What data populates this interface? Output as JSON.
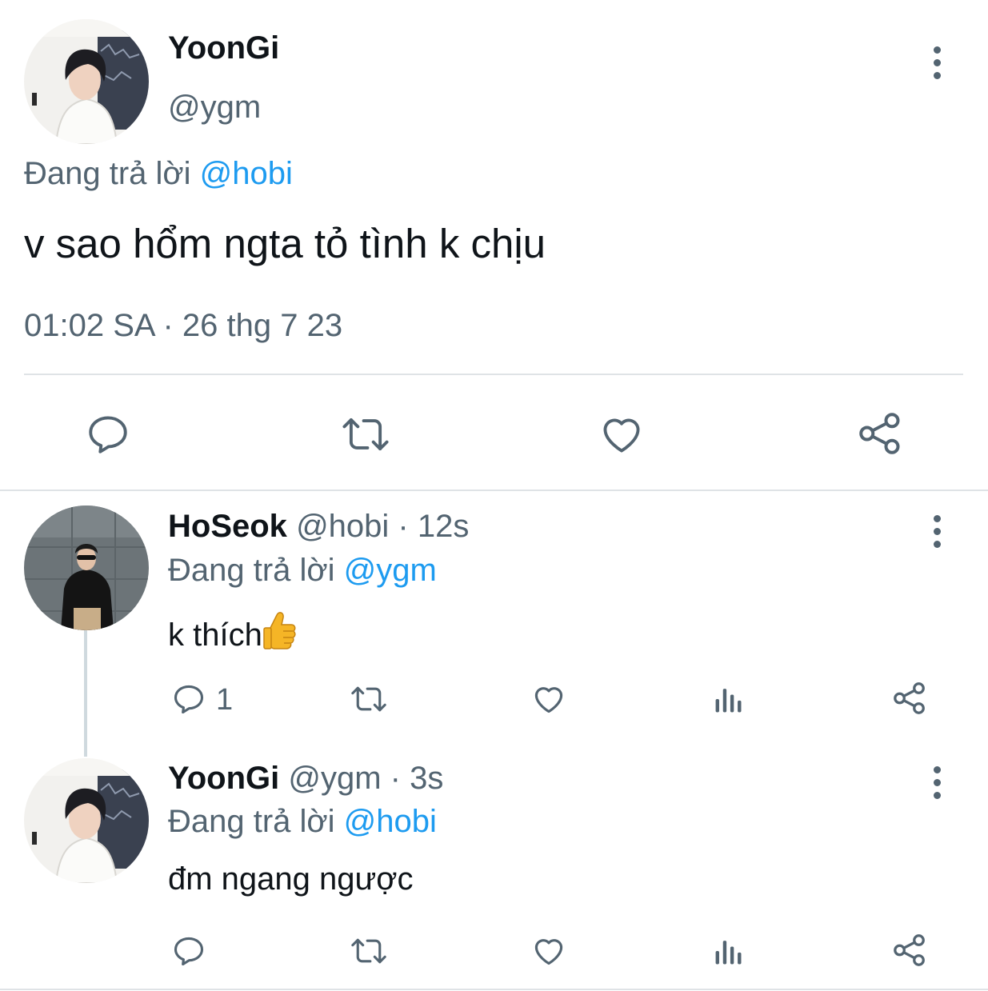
{
  "main_tweet": {
    "display_name": "YoonGi",
    "handle": "@ygm",
    "reply_prefix": "Đang trả lời",
    "reply_to": "@hobi",
    "text": "v sao hổm ngta tỏ tình k chịu",
    "timestamp": "01:02 SA · 26 thg 7 23",
    "actions": [
      "reply-icon",
      "retweet-icon",
      "like-icon",
      "share-icon"
    ]
  },
  "replies": [
    {
      "display_name": "HoSeok",
      "handle": "@hobi",
      "time": "· 12s",
      "reply_prefix": "Đang trả lời",
      "reply_to": "@ygm",
      "text": "k thích",
      "emoji": "thumbs-up",
      "reply_count": "1",
      "actions": [
        "reply-icon",
        "retweet-icon",
        "like-icon",
        "views-icon",
        "share-icon"
      ]
    },
    {
      "display_name": "YoonGi",
      "handle": "@ygm",
      "time": "· 3s",
      "reply_prefix": "Đang trả lời",
      "reply_to": "@hobi",
      "text": "đm ngang ngược",
      "reply_count": "",
      "actions": [
        "reply-icon",
        "retweet-icon",
        "like-icon",
        "views-icon",
        "share-icon"
      ]
    }
  ],
  "colors": {
    "text": "#0f1419",
    "secondary": "#536471",
    "link": "#1d9bf0",
    "divider": "#dfe3e6"
  }
}
